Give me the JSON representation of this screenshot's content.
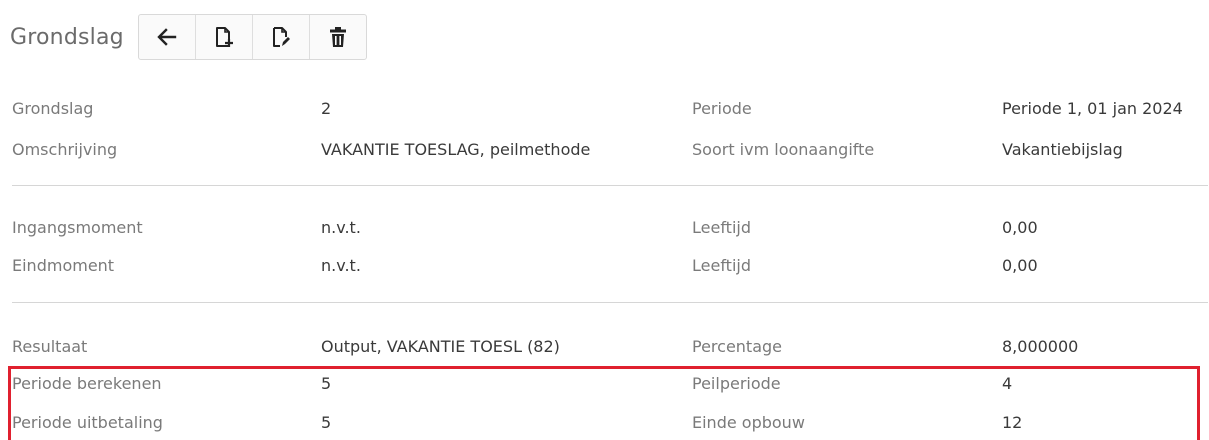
{
  "header": {
    "title": "Grondslag"
  },
  "toolbar": {
    "buttons": [
      {
        "icon": "arrow-left-icon"
      },
      {
        "icon": "new-document-icon"
      },
      {
        "icon": "edit-document-icon"
      },
      {
        "icon": "trash-icon"
      }
    ]
  },
  "section1": {
    "rows": [
      {
        "label1": "Grondslag",
        "value1": "2",
        "label2": "Periode",
        "value2": "Periode 1, 01 jan 2024"
      },
      {
        "label1": "Omschrijving",
        "value1": "VAKANTIE TOESLAG, peilmethode",
        "label2": "Soort ivm loonaangifte",
        "value2": "Vakantiebijslag"
      }
    ]
  },
  "section2": {
    "rows": [
      {
        "label1": "Ingangsmoment",
        "value1": "n.v.t.",
        "label2": "Leeftijd",
        "value2": "0,00"
      },
      {
        "label1": "Eindmoment",
        "value1": "n.v.t.",
        "label2": "Leeftijd",
        "value2": "0,00"
      }
    ]
  },
  "section3": {
    "rows": [
      {
        "label1": "Resultaat",
        "value1": "Output, VAKANTIE TOESL (82)",
        "label2": "Percentage",
        "value2": "8,000000"
      },
      {
        "label1": "Periode berekenen",
        "value1": "5",
        "label2": "Peilperiode",
        "value2": "4"
      },
      {
        "label1": "Periode uitbetaling",
        "value1": "5",
        "label2": "Einde opbouw",
        "value2": "12"
      }
    ]
  },
  "colors": {
    "highlight": "#e0202f",
    "divider": "#d6d6d6"
  }
}
